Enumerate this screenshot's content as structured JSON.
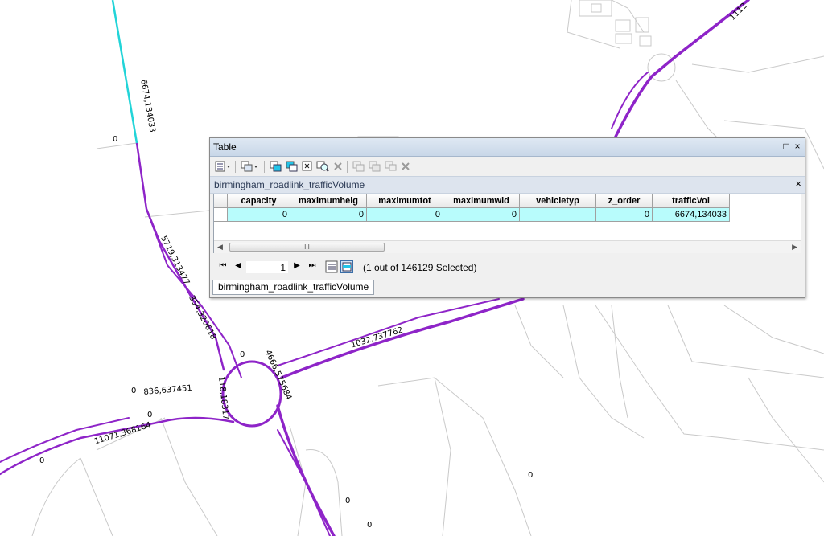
{
  "map": {
    "labels": [
      {
        "text": "6674,134033"
      },
      {
        "text": "0"
      },
      {
        "text": "5719,313477"
      },
      {
        "text": "354,320618"
      },
      {
        "text": "0"
      },
      {
        "text": "4666,575684"
      },
      {
        "text": "1032,737762"
      },
      {
        "text": "118,18317"
      },
      {
        "text": "0"
      },
      {
        "text": "836,637451"
      },
      {
        "text": "0"
      },
      {
        "text": "11071,368164"
      },
      {
        "text": "0"
      },
      {
        "text": "1112"
      },
      {
        "text": "0"
      },
      {
        "text": "0"
      },
      {
        "text": "0"
      }
    ],
    "colors": {
      "road": "#8e24c8",
      "selected_road": "#22d4d8",
      "background_lines": "#c9c9c9"
    }
  },
  "table_window": {
    "title": "Table",
    "restore_icon": "□",
    "close_icon": "×",
    "toolbar_icons": [
      "table-options-icon",
      "related-tables-icon",
      "select-by-attributes-icon",
      "switch-selection-icon",
      "clear-selection-icon",
      "zoom-to-selected-icon",
      "delete-selected-icon",
      "copy-icon",
      "paste-icon",
      "cut-icon",
      "delete-icon"
    ],
    "tab_name": "birmingham_roadlink_trafficVolume",
    "tab_close_icon": "×",
    "columns": [
      "capacity",
      "maximumheig",
      "maximumtot",
      "maximumwid",
      "vehicletyp",
      "z_order",
      "trafficVol"
    ],
    "rows": [
      [
        "0",
        "0",
        "0",
        "0",
        "",
        "0",
        "6674,134033"
      ]
    ],
    "scroll_thumb_grip": "III",
    "navigation": {
      "first_icon": "⏮",
      "prev_icon": "◀",
      "page": "1",
      "next_icon": "▶",
      "last_icon": "⏭",
      "status": "(1 out of 146129 Selected)"
    },
    "bottom_tab": "birmingham_roadlink_trafficVolume",
    "selection_color": "#b8fcfc"
  }
}
